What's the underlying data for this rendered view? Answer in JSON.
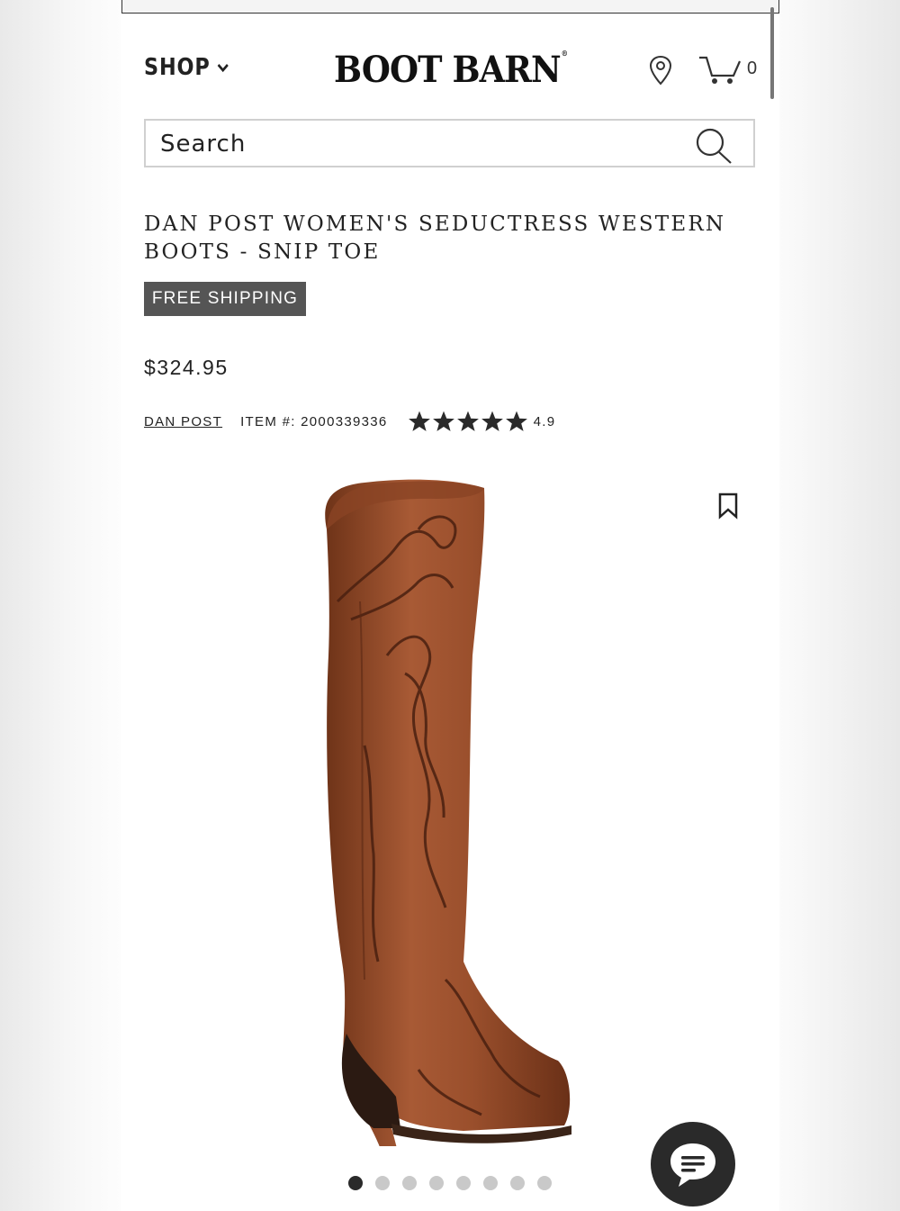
{
  "header": {
    "shop_label": "SHOP",
    "logo_text": "BOOT BARN",
    "cart_count": "0"
  },
  "search": {
    "placeholder": "Search"
  },
  "product": {
    "title": "DAN POST WOMEN'S SEDUCTRESS WESTERN BOOTS - SNIP TOE",
    "badge": "FREE SHIPPING",
    "price": "$324.95",
    "brand": "DAN POST",
    "item_number": "ITEM #: 2000339336",
    "rating": "4.9",
    "stars": 5,
    "image_dots": 8,
    "active_dot": 0
  },
  "colors": {
    "text": "#222222",
    "badge_bg": "#555555",
    "dot_inactive": "#c9c9c9",
    "dot_active": "#2a2a2a",
    "boot_leather": "#8e4a2b"
  },
  "icons": [
    "chevron-down-icon",
    "location-pin-icon",
    "cart-icon",
    "search-icon",
    "star-icon",
    "bookmark-icon",
    "chat-icon"
  ]
}
